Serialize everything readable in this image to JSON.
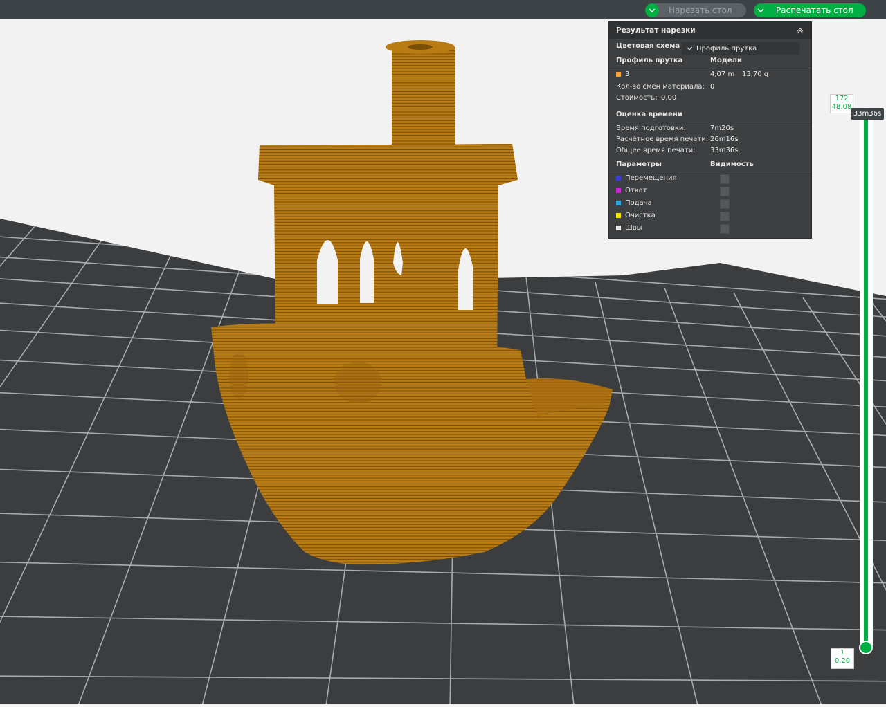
{
  "toolbar": {
    "slice_label": "Нарезать стол",
    "print_label": "Распечатать стол",
    "accent": "#00ae42"
  },
  "panel": {
    "title": "Результат нарезки",
    "color_scheme_label": "Цветовая схема",
    "color_scheme_value": "Профиль прутка",
    "col_filament": "Профиль прутка",
    "col_models": "Модели",
    "filament_row": {
      "name": "3",
      "length": "4,07 m",
      "weight": "13,70 g",
      "color": "#f5a33a"
    },
    "material_changes_label": "Кол-во смен материала:",
    "material_changes_value": "0",
    "cost_label": "Стоимость:",
    "cost_value": "0,00",
    "time_title": "Оценка времени",
    "prep_label": "Время подготовки:",
    "prep_value": "7m20s",
    "est_label": "Расчётное время печати:",
    "est_value": "26m16s",
    "total_label": "Общее время печати:",
    "total_value": "33m36s",
    "params_title": "Параметры",
    "visibility_title": "Видимость",
    "params": [
      {
        "label": "Перемещения",
        "color": "#3b3bd6"
      },
      {
        "label": "Откат",
        "color": "#c42dd1"
      },
      {
        "label": "Подача",
        "color": "#2aa3e0"
      },
      {
        "label": "Очистка",
        "color": "#f2e600"
      },
      {
        "label": "Швы",
        "color": "#e8e8e8"
      }
    ]
  },
  "slider": {
    "top_layer": "172",
    "top_height": "48,08",
    "time_tip": "33m36s",
    "bottom_layer": "1",
    "bottom_height": "0,20"
  }
}
